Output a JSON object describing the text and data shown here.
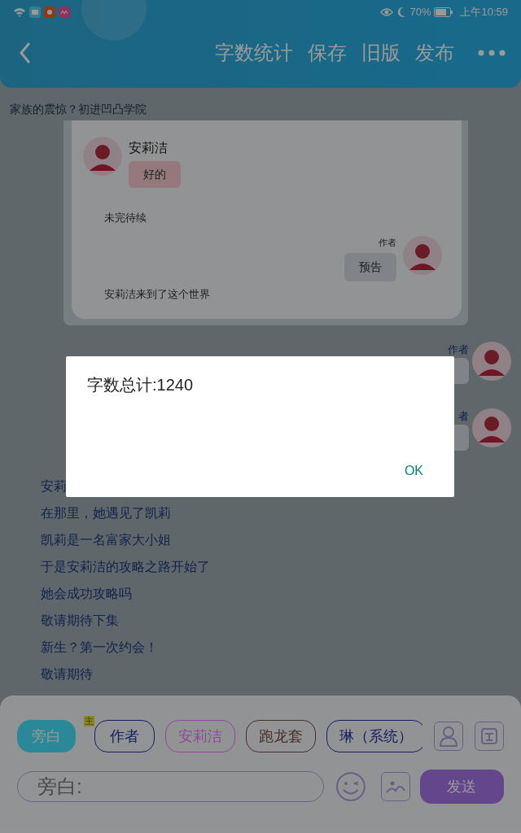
{
  "status_bar": {
    "battery": "70%",
    "time": "上午10:59"
  },
  "toolbar": {
    "actions": [
      "字数统计",
      "保存",
      "旧版",
      "发布"
    ]
  },
  "chapter_title": "家族的震惊？初进凹凸学院",
  "preview_messages": [
    {
      "kind": "left",
      "speaker": "安莉洁",
      "text": "好的"
    },
    {
      "kind": "narration",
      "text": "未完待续"
    },
    {
      "kind": "right",
      "speaker": "作者",
      "text": "预告"
    },
    {
      "kind": "narration",
      "text": "安莉洁来到了这个世界"
    }
  ],
  "side_messages": [
    {
      "speaker": "作者"
    },
    {
      "speaker": "者"
    }
  ],
  "narration_lines": [
    "安莉",
    "在那里，她遇见了凯莉",
    "凯莉是一名富家大小姐",
    "于是安莉洁的攻略之路开始了",
    "她会成功攻略吗",
    "敬请期待下集",
    "新生？第一次约会！",
    "敬请期待"
  ],
  "role_tabs": [
    {
      "label": "旁白",
      "selected": true,
      "color": "#2a8898"
    },
    {
      "label": "作者",
      "selected": false,
      "color": "#182060",
      "badge": "主"
    },
    {
      "label": "安莉洁",
      "selected": false,
      "color": "#904898"
    },
    {
      "label": "跑龙套",
      "selected": false,
      "color": "#4a3028"
    },
    {
      "label": "琳（系统）",
      "selected": false,
      "color": "#182060"
    }
  ],
  "input": {
    "placeholder": "旁白:"
  },
  "send_label": "发送",
  "dialog": {
    "message": "字数总计:1240",
    "button": "OK"
  }
}
